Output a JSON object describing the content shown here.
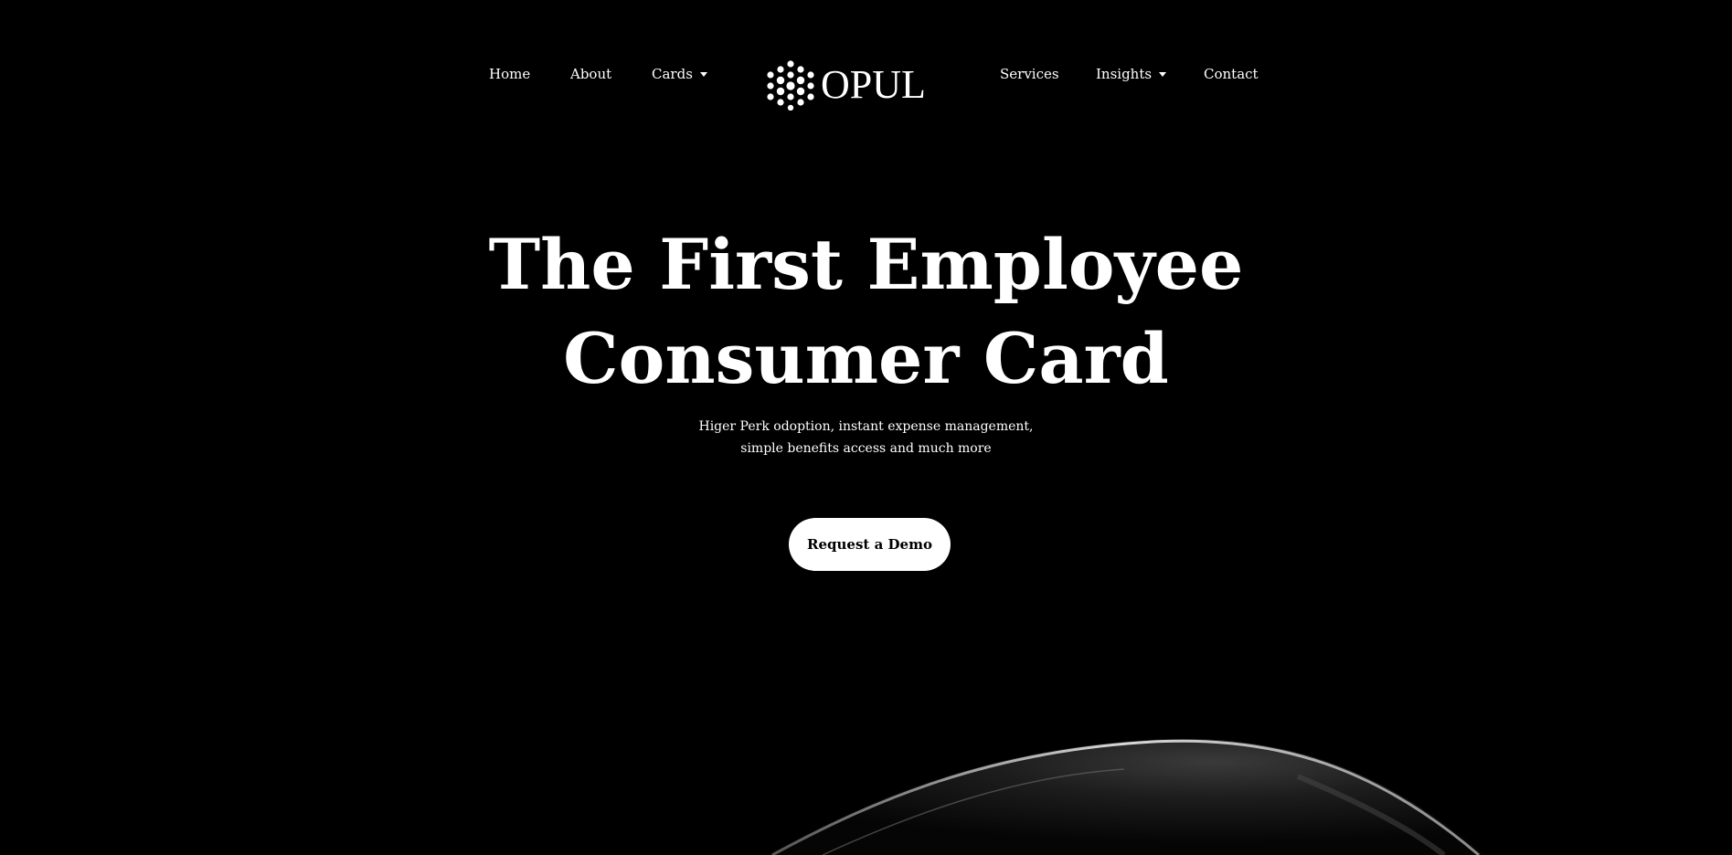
{
  "nav": {
    "left": [
      {
        "label": "Home"
      },
      {
        "label": "About"
      },
      {
        "label": "Cards"
      }
    ],
    "right": [
      {
        "label": "Services"
      },
      {
        "label": "Insights"
      },
      {
        "label": "Contact"
      }
    ],
    "logo_text": "OPUL"
  },
  "hero": {
    "title_line1": "The First Employee",
    "title_line2": "Consumer Card",
    "subtitle_line1": "Higer Perk odoption, instant expense management,",
    "subtitle_line2": "simple benefits access and much more",
    "cta_label": "Request a Demo"
  },
  "colors": {
    "background": "#000000",
    "text": "#ffffff",
    "button_bg": "#ffffff",
    "button_text": "#000000"
  }
}
